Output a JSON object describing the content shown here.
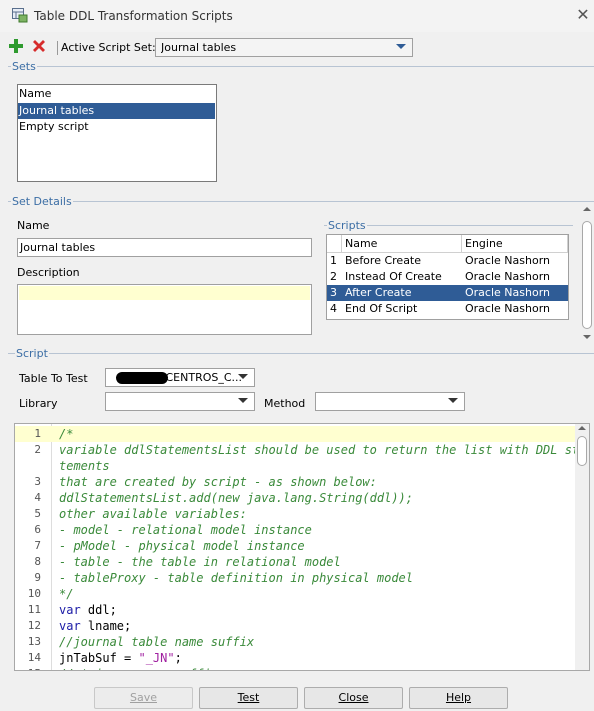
{
  "window": {
    "title": "Table DDL Transformation Scripts",
    "close_glyph": "✕"
  },
  "toolbar": {
    "active_script_set_label": "Active Script Set:",
    "active_script_set_value": "Journal tables"
  },
  "sets": {
    "group_label": "Sets",
    "column_header": "Name",
    "items": [
      "Journal tables",
      "Empty script"
    ],
    "selected_index": 0
  },
  "set_details": {
    "group_label": "Set Details",
    "name_label": "Name",
    "name_value": "Journal tables",
    "description_label": "Description",
    "description_value": ""
  },
  "scripts": {
    "group_label": "Scripts",
    "headers": [
      "",
      "Name",
      "Engine"
    ],
    "rows": [
      {
        "num": "1",
        "name": "Before Create",
        "engine": "Oracle Nashorn"
      },
      {
        "num": "2",
        "name": "Instead Of Create",
        "engine": "Oracle Nashorn"
      },
      {
        "num": "3",
        "name": "After Create",
        "engine": "Oracle Nashorn"
      },
      {
        "num": "4",
        "name": "End Of Script",
        "engine": "Oracle Nashorn"
      }
    ],
    "selected_index": 2
  },
  "script": {
    "group_label": "Script",
    "table_to_test_label": "Table To Test",
    "table_to_test_value": ".CENTROS_C...",
    "library_label": "Library",
    "library_value": "",
    "method_label": "Method",
    "method_value": "",
    "code_lines": [
      {
        "n": "1",
        "t": "/*",
        "c": "cmt"
      },
      {
        "n": "2",
        "t": "variable ddlStatementsList should be used to return the list with DDL sta",
        "c": "cmt"
      },
      {
        "n": "",
        "t": "tements",
        "c": "cmt"
      },
      {
        "n": "3",
        "t": "that are created by script - as shown below:",
        "c": "cmt"
      },
      {
        "n": "4",
        "t": "ddlStatementsList.add(new java.lang.String(ddl));",
        "c": "cmt"
      },
      {
        "n": "5",
        "t": "other available variables:",
        "c": "cmt"
      },
      {
        "n": "6",
        "t": "- model - relational model instance",
        "c": "cmt"
      },
      {
        "n": "7",
        "t": "- pModel - physical model instance",
        "c": "cmt"
      },
      {
        "n": "8",
        "t": "- table - the table in relational model",
        "c": "cmt"
      },
      {
        "n": "9",
        "t": "- tableProxy - table definition in physical model",
        "c": "cmt"
      },
      {
        "n": "10",
        "t": "*/",
        "c": "cmt"
      },
      {
        "n": "11",
        "t": "var ddl;",
        "c": "var"
      },
      {
        "n": "12",
        "t": "var lname;",
        "c": "var"
      },
      {
        "n": "13",
        "t": "//journal table name suffix",
        "c": "cmt"
      },
      {
        "n": "14",
        "t": "jnTabSuf = \"_JN\";",
        "c": "str"
      },
      {
        "n": "15",
        "t": "// trigger name suffix",
        "c": "cmt"
      }
    ]
  },
  "buttons": {
    "save": "Save",
    "test": "Test",
    "close": "Close",
    "help": "Help"
  },
  "colors": {
    "selection": "#2f5c96",
    "group_label": "#3c6ea5",
    "comment": "#3a8a3a",
    "keyword": "#1a1aa6",
    "string": "#a020a0"
  }
}
